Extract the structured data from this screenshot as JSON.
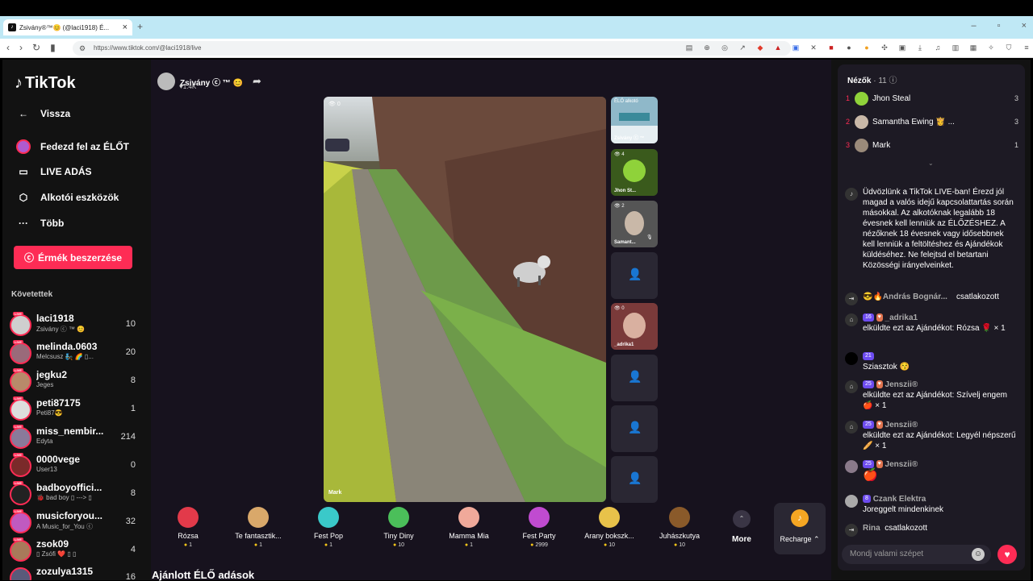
{
  "browser": {
    "tab_title": "Zsivány®™😊 (@laci1918) É...",
    "url": "https://www.tiktok.com/@laci1918/live",
    "new_tab": "+"
  },
  "sidebar": {
    "logo": "TikTok",
    "nav": [
      {
        "label": "Vissza",
        "icon": "back-arrow-icon"
      },
      {
        "label": "Fedezd fel az ÉLŐT",
        "icon": "live-avatar-icon"
      },
      {
        "label": "LIVE ADÁS",
        "icon": "video-camera-icon"
      },
      {
        "label": "Alkotói eszközök",
        "icon": "creator-tools-icon"
      },
      {
        "label": "Több",
        "icon": "more-dots-icon"
      }
    ],
    "coins_button": "Érmék beszerzése",
    "following_heading": "Követettek",
    "following": [
      {
        "name": "laci1918",
        "sub": "Zsivány ⓒ ™ 😊",
        "count": "10"
      },
      {
        "name": "melinda.0603",
        "sub": "Melcsusz 🧞 🌈 ▯...",
        "count": "20"
      },
      {
        "name": "jegku2",
        "sub": "Jeges",
        "count": "8"
      },
      {
        "name": "peti87175",
        "sub": "Peti87😎",
        "count": "1"
      },
      {
        "name": "miss_nembir...",
        "sub": "Edyta",
        "count": "214"
      },
      {
        "name": "0000vege",
        "sub": "User13",
        "count": "0"
      },
      {
        "name": "badboyoffici...",
        "sub": "🐞 bad boy ▯ ---> ▯",
        "count": "8"
      },
      {
        "name": "musicforyou...",
        "sub": "A Music_for_You ⓒ",
        "count": "32"
      },
      {
        "name": "zsok09",
        "sub": "▯ Zsófi ❤️ ▯ ▯",
        "count": "4"
      },
      {
        "name": "zozulya1315",
        "sub": "",
        "count": "16"
      }
    ]
  },
  "host": {
    "name": "Zsivány ⓒ ™ 😊",
    "likes": "♥1.4K"
  },
  "video": {
    "viewer_count": "👁 0",
    "label": "Mark"
  },
  "guests": [
    {
      "top_label": "ÉLŐ alkotó",
      "name": "Zsivány ⓒ ™",
      "color": "#8fb8c9"
    },
    {
      "top_label": "👁 4",
      "name": "Jhon St...",
      "color": "#3a5a1c"
    },
    {
      "top_label": "👁 2",
      "name": "Samant...",
      "color": "#555"
    },
    {
      "top_label": "",
      "name": "",
      "color": ""
    },
    {
      "top_label": "👁 0",
      "name": "_adrika1",
      "color": "#7a3a3a"
    },
    {
      "top_label": "",
      "name": "",
      "color": ""
    },
    {
      "top_label": "",
      "name": "",
      "color": ""
    },
    {
      "top_label": "",
      "name": "",
      "color": ""
    }
  ],
  "gifts": [
    {
      "name": "Rózsa",
      "price": "1",
      "color": "#e23a4a"
    },
    {
      "name": "Te fantasztik...",
      "price": "1",
      "color": "#d9a86a"
    },
    {
      "name": "Fest Pop",
      "price": "1",
      "color": "#3ac9c9"
    },
    {
      "name": "Tiny Diny",
      "price": "10",
      "color": "#4bbf5a"
    },
    {
      "name": "Mamma Mia",
      "price": "1",
      "color": "#f0a99a"
    },
    {
      "name": "Fest Party",
      "price": "2999",
      "color": "#c04bd0"
    },
    {
      "name": "Arany bokszk...",
      "price": "10",
      "color": "#e8c24a"
    },
    {
      "name": "Juhászkutya",
      "price": "10",
      "color": "#8a5a2a"
    }
  ],
  "more_label": "More",
  "recharge_label": "Recharge ⌃",
  "recommended": "Ajánlott ÉLŐ adások",
  "chat": {
    "viewers_title": "Nézők",
    "viewers_count": "· 11",
    "viewers": [
      {
        "rank": "1",
        "name": "Jhon Steal",
        "score": "3"
      },
      {
        "rank": "2",
        "name": "Samantha Ewing 👸 ...",
        "score": "3"
      },
      {
        "rank": "3",
        "name": "Mark",
        "score": "1"
      }
    ],
    "welcome": "Üdvözlünk a TikTok LIVE-ban! Érezd jól magad a valós idejű kapcsolattartás során másokkal. Az alkotóknak legalább 18 évesnek kell lenniük az ÉLŐZÉSHEZ. A nézőknek 18 évesnek vagy idősebbnek kell lenniük a feltöltéshez és Ajándékok küldéséhez. Ne felejtsd el betartani Közösségi irányelveinket.",
    "joined1_user": "😎🔥András Bognár...",
    "joined1_text": "csatlakozott",
    "gift1_level": "16",
    "gift1_user": "_adrika1",
    "gift1_text": "elküldte ezt az Ajándékot: Rózsa 🌹 × 1",
    "msg1_level": "21",
    "msg1_text": "Sziasztok 😚",
    "gift2_level": "25",
    "gift2_user": "Jenszii®",
    "gift2_text": "elküldte ezt az Ajándékot: Szívelj engem 🍎 × 1",
    "gift3_level": "25",
    "gift3_user": "Jenszii®",
    "gift3_text": "elküldte ezt az Ajándékot: Legyél népszerű 🥖 × 1",
    "msg2_level": "25",
    "msg2_user": "Jenszii®",
    "msg2_text": "🍎",
    "msg3_level": "8",
    "msg3_user": "Czank Elektra",
    "msg3_text": "Joreggelt mindenkinek",
    "joined2_user": "Rina",
    "joined2_text": "csatlakozott",
    "input_placeholder": "Mondj valami szépet"
  }
}
